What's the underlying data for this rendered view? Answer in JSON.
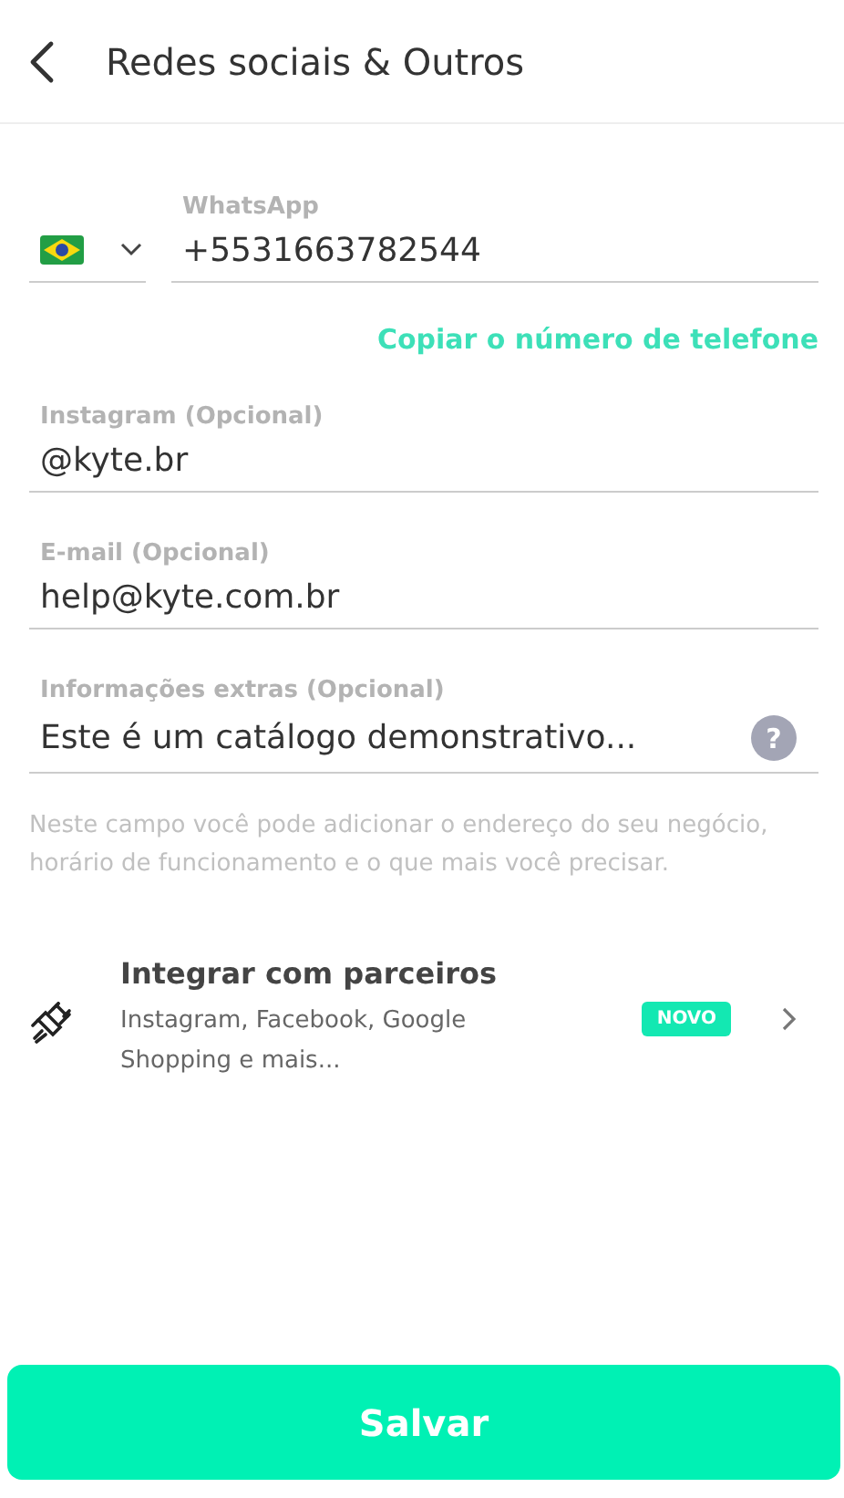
{
  "header": {
    "title": "Redes sociais & Outros"
  },
  "whatsapp": {
    "label": "WhatsApp",
    "value": "+5531663782544",
    "copy_link": "Copiar o número de telefone"
  },
  "fields": [
    {
      "kind": "text",
      "label": "Instagram (Opcional)",
      "value": "@kyte.br"
    },
    {
      "kind": "text",
      "label": "E-mail (Opcional)",
      "value": "help@kyte.com.br"
    },
    {
      "kind": "help",
      "label": "Informações extras (Opcional)",
      "value": "Este é um catálogo demonstrativo...",
      "help_icon": "?"
    }
  ],
  "hint": "Neste campo você pode adicionar o endereço do seu negócio, horário de funcionamento e o que mais você precisar.",
  "integration": {
    "title": "Integrar com parceiros",
    "subtitle": "Instagram, Facebook, Google Shopping e mais...",
    "badge": "NOVO"
  },
  "save_button": "Salvar"
}
